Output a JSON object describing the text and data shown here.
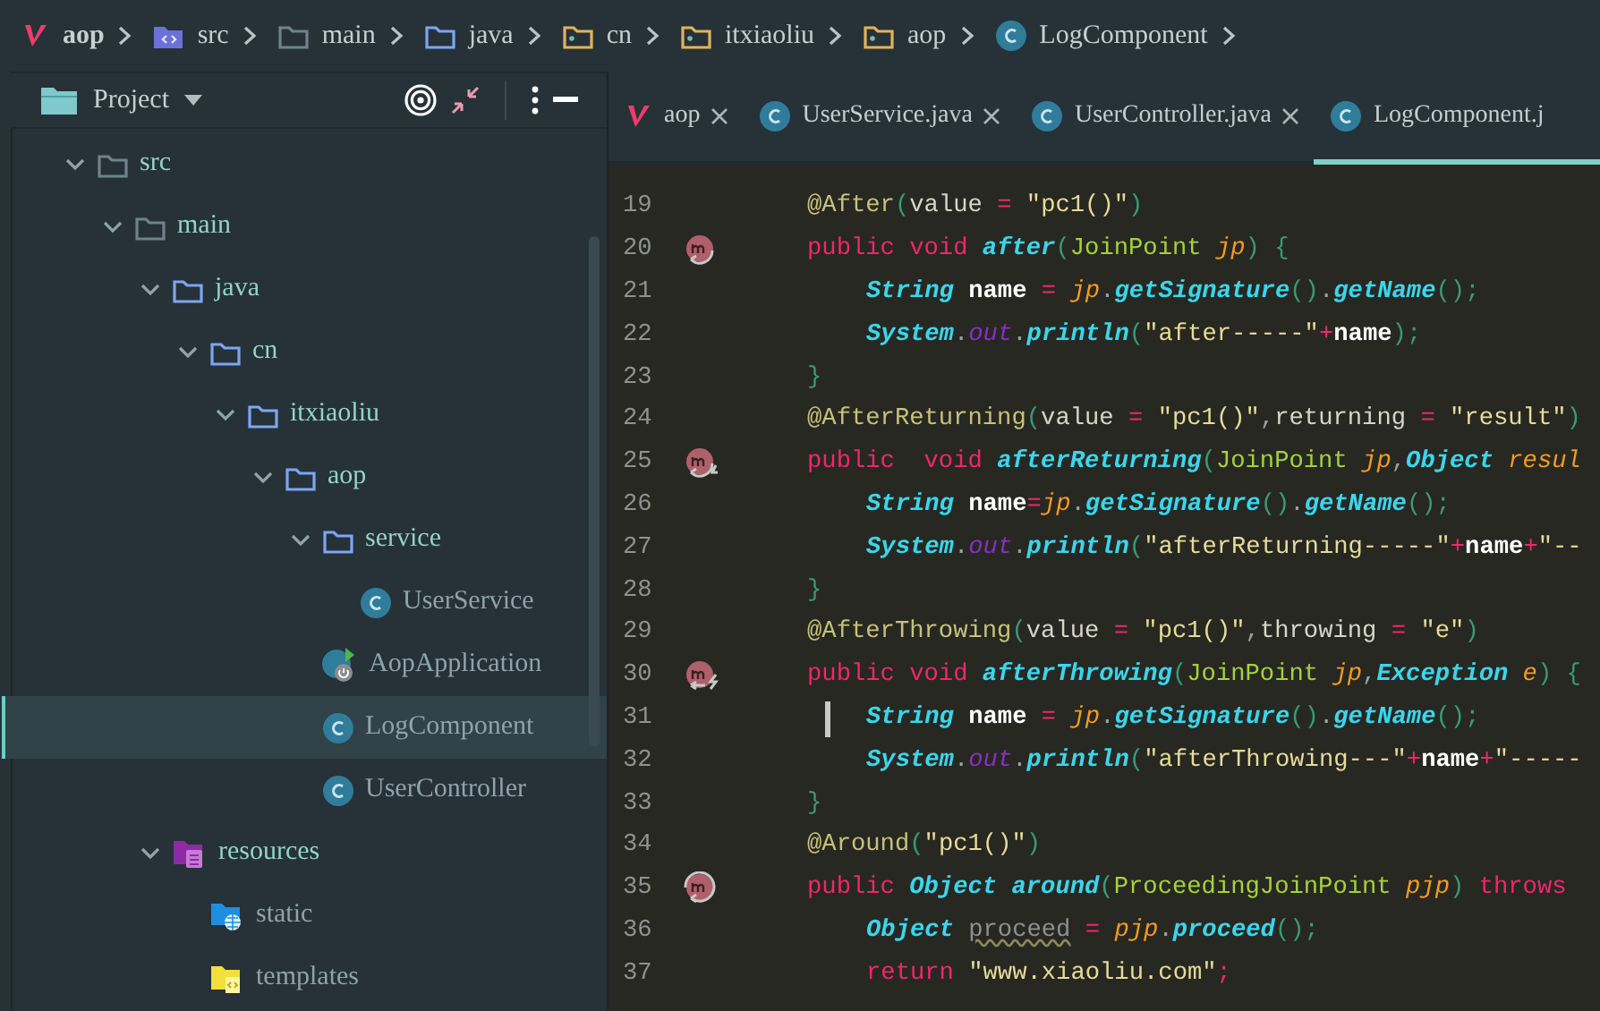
{
  "breadcrumb": [
    {
      "label": "aop",
      "kind": "module"
    },
    {
      "label": "src",
      "kind": "source"
    },
    {
      "label": "main",
      "kind": "folder"
    },
    {
      "label": "java",
      "kind": "java"
    },
    {
      "label": "cn",
      "kind": "package"
    },
    {
      "label": "itxiaoliu",
      "kind": "package"
    },
    {
      "label": "aop",
      "kind": "package"
    },
    {
      "label": "LogComponent",
      "kind": "class"
    }
  ],
  "project_panel": {
    "title": "Project",
    "tree": [
      {
        "label": "src",
        "kind": "folder",
        "expanded": true,
        "selected": false,
        "children": [
          {
            "label": "main",
            "kind": "folder",
            "expanded": true,
            "selected": false,
            "children": [
              {
                "label": "java",
                "kind": "java",
                "expanded": true,
                "selected": false,
                "children": [
                  {
                    "label": "cn",
                    "kind": "java",
                    "expanded": true,
                    "selected": false,
                    "children": [
                      {
                        "label": "itxiaoliu",
                        "kind": "java",
                        "expanded": true,
                        "selected": false,
                        "children": [
                          {
                            "label": "aop",
                            "kind": "java",
                            "expanded": true,
                            "selected": false,
                            "children": [
                              {
                                "label": "service",
                                "kind": "java",
                                "expanded": true,
                                "selected": false,
                                "children": [
                                  {
                                    "label": "UserService",
                                    "kind": "class",
                                    "selected": false
                                  }
                                ]
                              },
                              {
                                "label": "AopApplication",
                                "kind": "spring",
                                "selected": false
                              },
                              {
                                "label": "LogComponent",
                                "kind": "class",
                                "selected": true
                              },
                              {
                                "label": "UserController",
                                "kind": "class",
                                "selected": false
                              }
                            ]
                          }
                        ]
                      }
                    ]
                  }
                ]
              },
              {
                "label": "resources",
                "kind": "resources",
                "expanded": true,
                "selected": false,
                "children": [
                  {
                    "label": "static",
                    "kind": "web"
                  },
                  {
                    "label": "templates",
                    "kind": "templates"
                  }
                ]
              }
            ]
          }
        ]
      }
    ]
  },
  "tabs": [
    {
      "label": "aop",
      "kind": "module",
      "selected": false
    },
    {
      "label": "UserService.java",
      "kind": "class",
      "selected": false
    },
    {
      "label": "UserController.java",
      "kind": "class",
      "selected": false
    },
    {
      "label": "LogComponent.j",
      "kind": "class",
      "selected": true
    }
  ],
  "editor": {
    "lines": [
      {
        "number": "19",
        "kind": "decl",
        "cursor": false,
        "tokens": [
          {
            "text": "@After",
            "kind": "ann"
          },
          {
            "text": "(",
            "kind": "paren"
          },
          {
            "text": "value ",
            "kind": "plain"
          },
          {
            "text": "=",
            "kind": "op"
          },
          {
            "text": " \"pc1()\"",
            "kind": "str"
          },
          {
            "text": ")",
            "kind": "paren"
          }
        ]
      },
      {
        "number": "20",
        "kind": "decl",
        "marker": {
          "kind": "after"
        },
        "cursor": false,
        "tokens": [
          {
            "text": "public void ",
            "kind": "kw"
          },
          {
            "text": "after",
            "kind": "method"
          },
          {
            "text": "(",
            "kind": "paren"
          },
          {
            "text": "JoinPoint ",
            "kind": "cls"
          },
          {
            "text": "jp",
            "kind": "param"
          },
          {
            "text": ") {",
            "kind": "paren"
          }
        ]
      },
      {
        "number": "21",
        "kind": "body",
        "cursor": false,
        "tokens": [
          {
            "text": "String ",
            "kind": "type"
          },
          {
            "text": "name",
            "kind": "var"
          },
          {
            "text": " = ",
            "kind": "op"
          },
          {
            "text": "jp",
            "kind": "param"
          },
          {
            "text": ".",
            "kind": "punct"
          },
          {
            "text": "getSignature",
            "kind": "method"
          },
          {
            "text": "()",
            "kind": "paren"
          },
          {
            "text": ".",
            "kind": "punct"
          },
          {
            "text": "getName",
            "kind": "method"
          },
          {
            "text": "();",
            "kind": "paren"
          }
        ]
      },
      {
        "number": "22",
        "kind": "body",
        "cursor": false,
        "tokens": [
          {
            "text": "System",
            "kind": "type"
          },
          {
            "text": ".",
            "kind": "punct"
          },
          {
            "text": "out",
            "kind": "field"
          },
          {
            "text": ".",
            "kind": "punct"
          },
          {
            "text": "println",
            "kind": "method"
          },
          {
            "text": "(",
            "kind": "paren"
          },
          {
            "text": "\"after-----\"",
            "kind": "str"
          },
          {
            "text": "+",
            "kind": "op"
          },
          {
            "text": "name",
            "kind": "var"
          },
          {
            "text": ");",
            "kind": "paren"
          }
        ]
      },
      {
        "number": "23",
        "kind": "decl",
        "cursor": false,
        "tokens": [
          {
            "text": "}",
            "kind": "paren"
          }
        ]
      },
      {
        "number": "24",
        "kind": "decl",
        "cursor": false,
        "tokens": [
          {
            "text": "@AfterReturning",
            "kind": "ann"
          },
          {
            "text": "(",
            "kind": "paren"
          },
          {
            "text": "value ",
            "kind": "plain"
          },
          {
            "text": "=",
            "kind": "op"
          },
          {
            "text": " \"pc1()\"",
            "kind": "str"
          },
          {
            "text": ",",
            "kind": "punct"
          },
          {
            "text": "returning ",
            "kind": "plain"
          },
          {
            "text": "=",
            "kind": "op"
          },
          {
            "text": " \"result\"",
            "kind": "str"
          },
          {
            "text": ")",
            "kind": "paren"
          }
        ]
      },
      {
        "number": "25",
        "kind": "decl",
        "marker": {
          "kind": "returning"
        },
        "cursor": false,
        "tokens": [
          {
            "text": "public  void ",
            "kind": "kw"
          },
          {
            "text": "afterReturning",
            "kind": "method"
          },
          {
            "text": "(",
            "kind": "paren"
          },
          {
            "text": "JoinPoint ",
            "kind": "cls"
          },
          {
            "text": "jp",
            "kind": "param"
          },
          {
            "text": ",",
            "kind": "punct"
          },
          {
            "text": "Object ",
            "kind": "type"
          },
          {
            "text": "resul",
            "kind": "param"
          }
        ]
      },
      {
        "number": "26",
        "kind": "body",
        "cursor": false,
        "tokens": [
          {
            "text": "String ",
            "kind": "type"
          },
          {
            "text": "name",
            "kind": "var"
          },
          {
            "text": "=",
            "kind": "op"
          },
          {
            "text": "jp",
            "kind": "param"
          },
          {
            "text": ".",
            "kind": "punct"
          },
          {
            "text": "getSignature",
            "kind": "method"
          },
          {
            "text": "()",
            "kind": "paren"
          },
          {
            "text": ".",
            "kind": "punct"
          },
          {
            "text": "getName",
            "kind": "method"
          },
          {
            "text": "();",
            "kind": "paren"
          }
        ]
      },
      {
        "number": "27",
        "kind": "body",
        "cursor": false,
        "tokens": [
          {
            "text": "System",
            "kind": "type"
          },
          {
            "text": ".",
            "kind": "punct"
          },
          {
            "text": "out",
            "kind": "field"
          },
          {
            "text": ".",
            "kind": "punct"
          },
          {
            "text": "println",
            "kind": "method"
          },
          {
            "text": "(",
            "kind": "paren"
          },
          {
            "text": "\"afterReturning-----\"",
            "kind": "str"
          },
          {
            "text": "+",
            "kind": "op"
          },
          {
            "text": "name",
            "kind": "var"
          },
          {
            "text": "+",
            "kind": "op"
          },
          {
            "text": "\"--",
            "kind": "str"
          }
        ]
      },
      {
        "number": "28",
        "kind": "decl",
        "cursor": false,
        "tokens": [
          {
            "text": "}",
            "kind": "paren"
          }
        ]
      },
      {
        "number": "29",
        "kind": "decl",
        "cursor": false,
        "tokens": [
          {
            "text": "@AfterThrowing",
            "kind": "ann"
          },
          {
            "text": "(",
            "kind": "paren"
          },
          {
            "text": "value ",
            "kind": "plain"
          },
          {
            "text": "=",
            "kind": "op"
          },
          {
            "text": " \"pc1()\"",
            "kind": "str"
          },
          {
            "text": ",",
            "kind": "punct"
          },
          {
            "text": "throwing ",
            "kind": "plain"
          },
          {
            "text": "=",
            "kind": "op"
          },
          {
            "text": " \"e\"",
            "kind": "str"
          },
          {
            "text": ")",
            "kind": "paren"
          }
        ]
      },
      {
        "number": "30",
        "kind": "decl",
        "marker": {
          "kind": "throwing"
        },
        "cursor": false,
        "tokens": [
          {
            "text": "public void ",
            "kind": "kw"
          },
          {
            "text": "afterThrowing",
            "kind": "method"
          },
          {
            "text": "(",
            "kind": "paren"
          },
          {
            "text": "JoinPoint ",
            "kind": "cls"
          },
          {
            "text": "jp",
            "kind": "param"
          },
          {
            "text": ",",
            "kind": "punct"
          },
          {
            "text": "Exception ",
            "kind": "type"
          },
          {
            "text": "e",
            "kind": "param"
          },
          {
            "text": ") {",
            "kind": "paren"
          }
        ]
      },
      {
        "number": "31",
        "kind": "body",
        "cursor": true,
        "tokens": [
          {
            "text": "String ",
            "kind": "type"
          },
          {
            "text": "name",
            "kind": "var"
          },
          {
            "text": " = ",
            "kind": "op"
          },
          {
            "text": "jp",
            "kind": "param"
          },
          {
            "text": ".",
            "kind": "punct"
          },
          {
            "text": "getSignature",
            "kind": "method"
          },
          {
            "text": "()",
            "kind": "paren"
          },
          {
            "text": ".",
            "kind": "punct"
          },
          {
            "text": "getName",
            "kind": "method"
          },
          {
            "text": "();",
            "kind": "paren"
          }
        ]
      },
      {
        "number": "32",
        "kind": "body",
        "cursor": false,
        "tokens": [
          {
            "text": "System",
            "kind": "type"
          },
          {
            "text": ".",
            "kind": "punct"
          },
          {
            "text": "out",
            "kind": "field"
          },
          {
            "text": ".",
            "kind": "punct"
          },
          {
            "text": "println",
            "kind": "method"
          },
          {
            "text": "(",
            "kind": "paren"
          },
          {
            "text": "\"afterThrowing---\"",
            "kind": "str"
          },
          {
            "text": "+",
            "kind": "op"
          },
          {
            "text": "name",
            "kind": "var"
          },
          {
            "text": "+",
            "kind": "op"
          },
          {
            "text": "\"-----",
            "kind": "str"
          }
        ]
      },
      {
        "number": "33",
        "kind": "decl",
        "cursor": false,
        "tokens": [
          {
            "text": "}",
            "kind": "paren"
          }
        ]
      },
      {
        "number": "34",
        "kind": "decl",
        "cursor": false,
        "tokens": [
          {
            "text": "@Around",
            "kind": "ann"
          },
          {
            "text": "(",
            "kind": "paren"
          },
          {
            "text": "\"pc1()\"",
            "kind": "str"
          },
          {
            "text": ")",
            "kind": "paren"
          }
        ]
      },
      {
        "number": "35",
        "kind": "decl",
        "marker": {
          "kind": "around"
        },
        "cursor": false,
        "tokens": [
          {
            "text": "public ",
            "kind": "kw"
          },
          {
            "text": "Object ",
            "kind": "type"
          },
          {
            "text": "around",
            "kind": "method"
          },
          {
            "text": "(",
            "kind": "paren"
          },
          {
            "text": "ProceedingJoinPoint ",
            "kind": "cls"
          },
          {
            "text": "pjp",
            "kind": "param"
          },
          {
            "text": ") ",
            "kind": "paren"
          },
          {
            "text": "throws",
            "kind": "kw"
          }
        ]
      },
      {
        "number": "36",
        "kind": "body",
        "cursor": false,
        "tokens": [
          {
            "text": "Object ",
            "kind": "type"
          },
          {
            "text": "proceed",
            "kind": "unused"
          },
          {
            "text": " = ",
            "kind": "op"
          },
          {
            "text": "pjp",
            "kind": "param"
          },
          {
            "text": ".",
            "kind": "punct"
          },
          {
            "text": "proceed",
            "kind": "method"
          },
          {
            "text": "();",
            "kind": "paren"
          }
        ]
      },
      {
        "number": "37",
        "kind": "body",
        "cursor": false,
        "tokens": [
          {
            "text": "return ",
            "kind": "kw"
          },
          {
            "text": "\"www.xiaoliu.com\"",
            "kind": "str"
          },
          {
            "text": ";",
            "kind": "op"
          }
        ]
      }
    ]
  }
}
